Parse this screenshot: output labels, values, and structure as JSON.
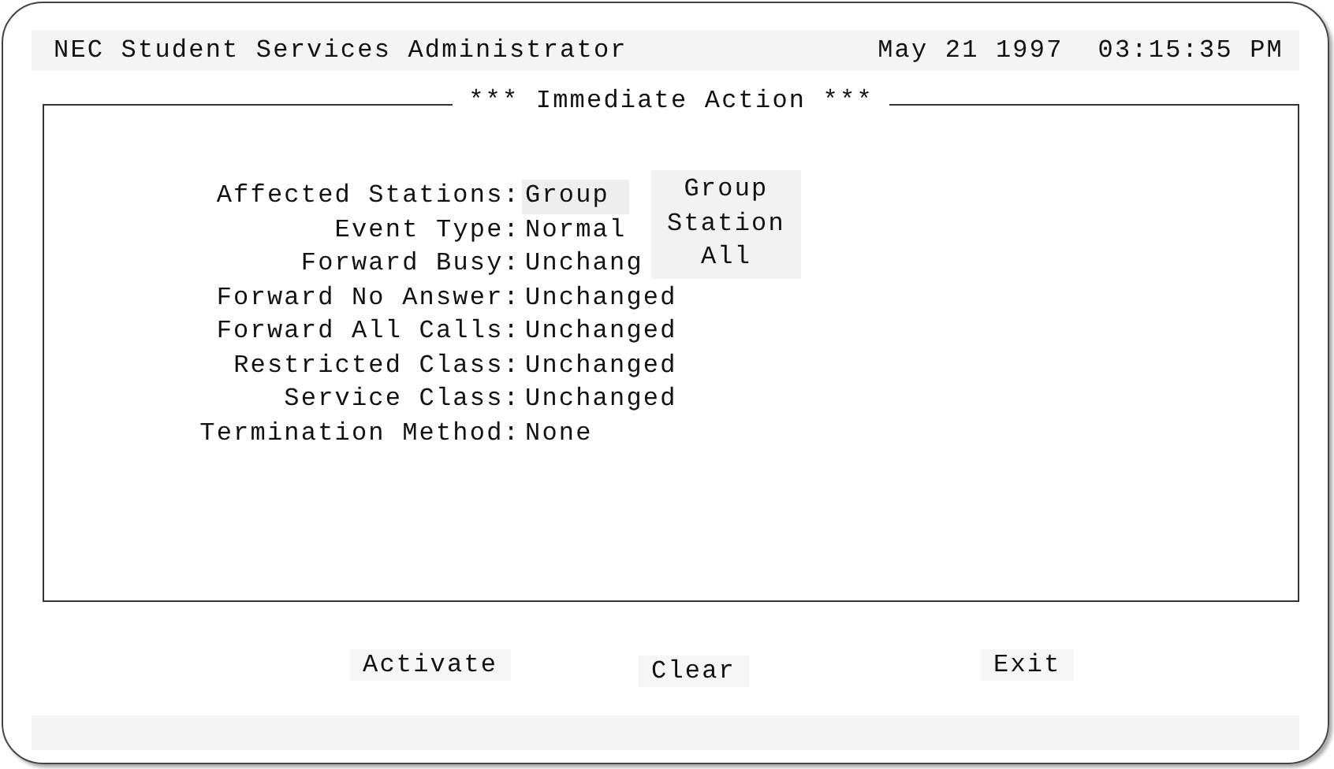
{
  "header": {
    "title": "NEC Student Services Administrator",
    "date": "May 21 1997",
    "time": "03:15:35 PM"
  },
  "panel": {
    "title": "*** Immediate Action ***",
    "fields": [
      {
        "label": "Affected Stations:",
        "value": "Group",
        "focused": true
      },
      {
        "label": "Event Type:",
        "value": "Normal",
        "focused": false
      },
      {
        "label": "Forward Busy:",
        "value": "Unchang",
        "focused": false
      },
      {
        "label": "Forward No Answer:",
        "value": "Unchanged",
        "focused": false
      },
      {
        "label": "Forward All Calls:",
        "value": "Unchanged",
        "focused": false
      },
      {
        "label": "Restricted Class:",
        "value": "Unchanged",
        "focused": false
      },
      {
        "label": "Service Class:",
        "value": "Unchanged",
        "focused": false
      },
      {
        "label": "Termination Method:",
        "value": "None",
        "focused": false
      }
    ],
    "dropdown": {
      "options": [
        "Group",
        "Station",
        "All"
      ]
    }
  },
  "buttons": [
    "Activate",
    "Clear",
    "Exit"
  ]
}
